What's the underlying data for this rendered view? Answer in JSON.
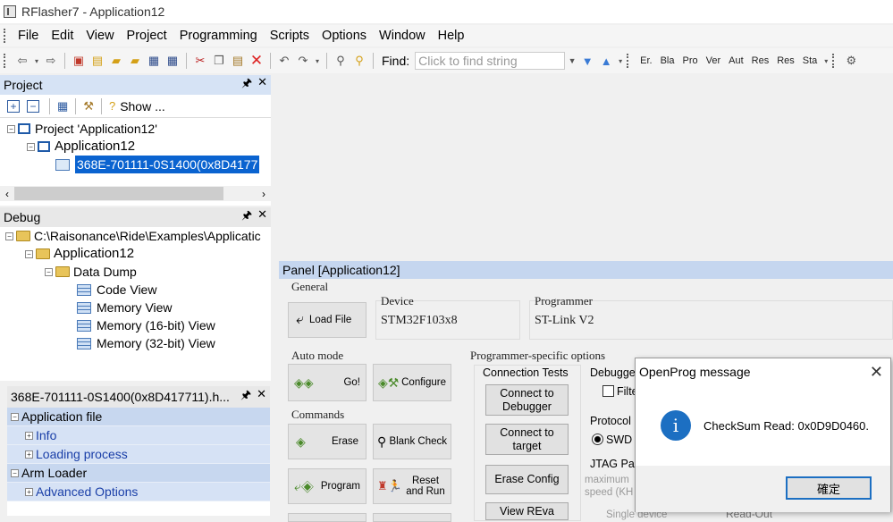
{
  "window": {
    "title": "RFlasher7 - Application12"
  },
  "menu": [
    "File",
    "Edit",
    "View",
    "Project",
    "Programming",
    "Scripts",
    "Options",
    "Window",
    "Help"
  ],
  "toolbar": {
    "find_label": "Find:",
    "find_placeholder": "Click to find string",
    "small_buttons": [
      "Er.",
      "Bla",
      "Pro",
      "Ver",
      "Aut",
      "Res",
      "Res",
      "Sta"
    ]
  },
  "project_panel": {
    "title": "Project",
    "show_label": "Show ...",
    "root": "Project 'Application12'",
    "app": "Application12",
    "file": "368E-701111-0S1400(0x8D4177"
  },
  "debug_panel": {
    "title": "Debug",
    "path": "C:\\Raisonance\\Ride\\Examples\\Applicatic",
    "app": "Application12",
    "folder": "Data Dump",
    "views": [
      "Code View",
      "Memory View",
      "Memory (16-bit) View",
      "Memory (32-bit) View"
    ]
  },
  "props_panel": {
    "title": "368E-701111-0S1400(0x8D417711).h...",
    "sections": [
      {
        "label": "Application file",
        "items": [
          "Info",
          "Loading process"
        ]
      },
      {
        "label": "Arm Loader",
        "items": [
          "Advanced Options"
        ]
      }
    ]
  },
  "main_panel": {
    "title": "Panel [Application12]",
    "general": "General",
    "load_file": "Load File",
    "device_label": "Device",
    "device_value": "STM32F103x8",
    "programmer_label": "Programmer",
    "programmer_value": "ST-Link V2",
    "auto_mode": "Auto mode",
    "go": "Go!",
    "configure": "Configure",
    "commands": "Commands",
    "erase": "Erase",
    "blank_check": "Blank Check",
    "program": "Program",
    "reset_run": "Reset and Run",
    "prog_specific": "Programmer-specific options",
    "conn_tests": "Connection Tests",
    "connect_debugger": "Connect to Debugger",
    "connect_target": "Connect to target",
    "erase_config": "Erase Config",
    "view_reva": "View REva",
    "debugger_label": "Debugger",
    "filter_label": "Filte",
    "protocol_label": "Protocol",
    "swd_label": "SWD",
    "jtag_label": "JTAG Par",
    "max_speed": "maximum speed (KH",
    "single_device": "Single device",
    "readout": "Read-Out"
  },
  "dialog": {
    "title": "OpenProg message",
    "message": "CheckSum Read: 0x0D9D0460.",
    "ok": "確定"
  }
}
